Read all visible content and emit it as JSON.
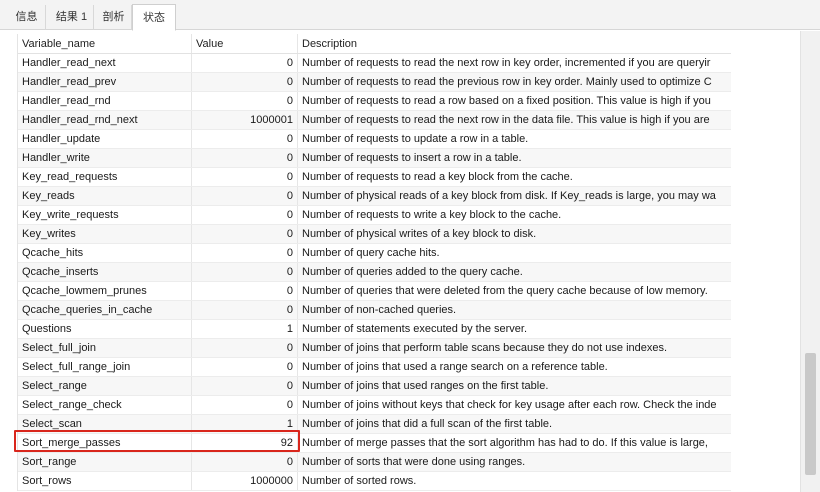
{
  "tabs": [
    {
      "label": "信息"
    },
    {
      "label": "结果 1"
    },
    {
      "label": "剖析"
    },
    {
      "label": "状态"
    }
  ],
  "active_tab": "状态",
  "columns": {
    "variable": "Variable_name",
    "value": "Value",
    "description": "Description"
  },
  "rows": [
    {
      "name": "Handler_read_next",
      "value": "0",
      "description": "Number of requests to read the next row in key order, incremented if you are queryir"
    },
    {
      "name": "Handler_read_prev",
      "value": "0",
      "description": "Number of requests to read the previous row in key order. Mainly used to optimize C"
    },
    {
      "name": "Handler_read_rnd",
      "value": "0",
      "description": "Number of requests to read a row based on a fixed position. This value is high if you"
    },
    {
      "name": "Handler_read_rnd_next",
      "value": "1000001",
      "description": "Number of requests to read the next row in the data file. This value is high if you are"
    },
    {
      "name": "Handler_update",
      "value": "0",
      "description": "Number of requests to update a row in a table."
    },
    {
      "name": "Handler_write",
      "value": "0",
      "description": "Number of requests to insert a row in a table."
    },
    {
      "name": "Key_read_requests",
      "value": "0",
      "description": "Number of requests to read a key block from the cache."
    },
    {
      "name": "Key_reads",
      "value": "0",
      "description": "Number of physical reads of a key block from disk. If Key_reads is large, you may wa"
    },
    {
      "name": "Key_write_requests",
      "value": "0",
      "description": "Number of requests to write a key block to the cache."
    },
    {
      "name": "Key_writes",
      "value": "0",
      "description": "Number of physical writes of a key block to disk."
    },
    {
      "name": "Qcache_hits",
      "value": "0",
      "description": "Number of query cache hits."
    },
    {
      "name": "Qcache_inserts",
      "value": "0",
      "description": "Number of queries added to the query cache."
    },
    {
      "name": "Qcache_lowmem_prunes",
      "value": "0",
      "description": "Number of queries that were deleted from the query cache because of low memory."
    },
    {
      "name": "Qcache_queries_in_cache",
      "value": "0",
      "description": "Number of non-cached queries."
    },
    {
      "name": "Questions",
      "value": "1",
      "description": "Number of statements executed by the server."
    },
    {
      "name": "Select_full_join",
      "value": "0",
      "description": "Number of joins that perform table scans because they do not use indexes."
    },
    {
      "name": "Select_full_range_join",
      "value": "0",
      "description": "Number of joins that used a range search on a reference table."
    },
    {
      "name": "Select_range",
      "value": "0",
      "description": "Number of joins that used ranges on the first table."
    },
    {
      "name": "Select_range_check",
      "value": "0",
      "description": "Number of joins without keys that check for key usage after each row. Check the inde"
    },
    {
      "name": "Select_scan",
      "value": "1",
      "description": "Number of joins that did a full scan of the first table."
    },
    {
      "name": "Sort_merge_passes",
      "value": "92",
      "description": "Number of merge passes that the sort algorithm has had to do. If this value is large,"
    },
    {
      "name": "Sort_range",
      "value": "0",
      "description": "Number of sorts that were done using ranges."
    },
    {
      "name": "Sort_rows",
      "value": "1000000",
      "description": "Number of sorted rows."
    }
  ],
  "highlighted_row": "Sort_merge_passes",
  "colors": {
    "highlight_border": "#d9261c",
    "tab_bar": "#f3f3f3",
    "alt_row": "#f7f7f7"
  }
}
